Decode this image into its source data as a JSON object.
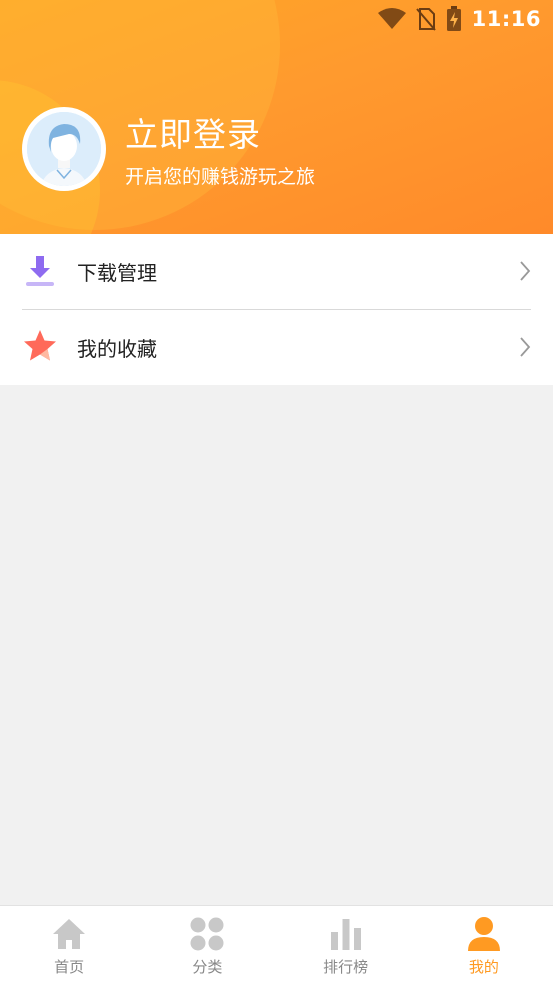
{
  "status_bar": {
    "time": "11:16"
  },
  "profile": {
    "title": "立即登录",
    "subtitle": "开启您的赚钱游玩之旅"
  },
  "menu": {
    "items": [
      {
        "label": "下载管理",
        "icon": "download-icon"
      },
      {
        "label": "我的收藏",
        "icon": "star-icon"
      }
    ]
  },
  "bottom_nav": {
    "items": [
      {
        "label": "首页",
        "icon": "home-icon",
        "active": false
      },
      {
        "label": "分类",
        "icon": "category-icon",
        "active": false
      },
      {
        "label": "排行榜",
        "icon": "ranking-icon",
        "active": false
      },
      {
        "label": "我的",
        "icon": "user-icon",
        "active": true
      }
    ]
  },
  "colors": {
    "accent": "#ff9a22",
    "header": "#ff9a2e",
    "inactive": "#c8c8c8",
    "download": "#8e6bf0",
    "star": "#ff6a5a"
  }
}
